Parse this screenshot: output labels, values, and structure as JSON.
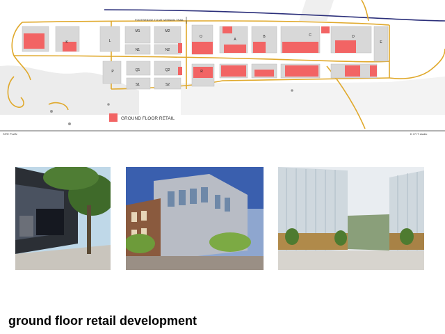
{
  "site_plan": {
    "title": "SITE PLAN",
    "footbridge_label": "FOOTBRIDGE TO MT VERNON TRAIL",
    "legend_label": "GROUND FLOOR RETAIL",
    "credit": "D I R T   studio",
    "colors": {
      "retail": "#f26464",
      "block": "#d8d8d8",
      "road": "#e0a92c",
      "rail": "#2b2f7a"
    },
    "block_labels": [
      "K",
      "L",
      "M1",
      "M2",
      "N1",
      "N2",
      "O",
      "A",
      "B",
      "C",
      "D",
      "E",
      "P",
      "Q1",
      "Q2",
      "R",
      "S1",
      "S2"
    ]
  },
  "photos": [
    {
      "name": "street-retail-arcade-photo"
    },
    {
      "name": "corner-retail-building-photo"
    },
    {
      "name": "glass-courtyard-rendering-photo"
    }
  ],
  "caption": "ground floor retail development"
}
